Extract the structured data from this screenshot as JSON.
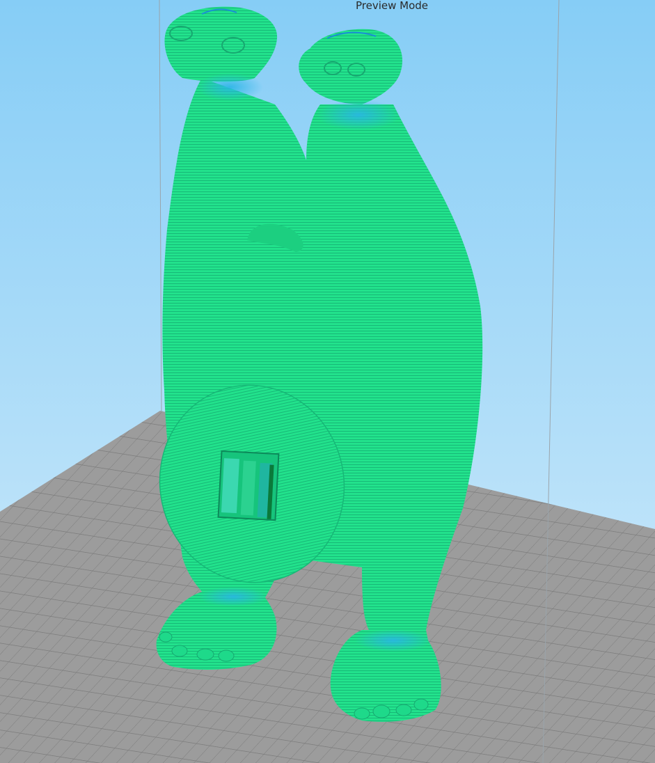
{
  "viewport": {
    "mode_label": "Preview Mode",
    "model_color": "#1fe08a",
    "background_top": "#7cc9f5",
    "background_bottom": "#cfe9fb",
    "bed_color": "#9a9a9a",
    "bed_grid_color": "#7c7c7c",
    "volume_edge_color": "#9aa4ab"
  }
}
